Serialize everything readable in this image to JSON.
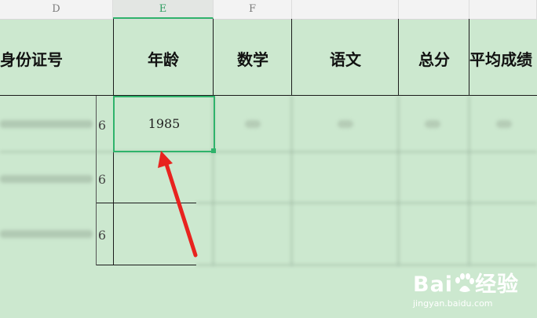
{
  "sheet": {
    "columns": [
      "D",
      "E",
      "F"
    ],
    "selected_column": "E",
    "headers": [
      "身份证号",
      "年龄",
      "数学",
      "语文",
      "总分",
      "平均成绩"
    ],
    "rows": [
      {
        "id_suffix": "6",
        "age": "1985"
      },
      {
        "id_suffix": "6",
        "age": ""
      },
      {
        "id_suffix": "6",
        "age": ""
      }
    ],
    "active_cell_value": "1985"
  },
  "watermark": {
    "logo": "Baidu经验",
    "url": "jingyan.baidu.com"
  },
  "colors": {
    "background": "#cce8cf",
    "selection": "#2fb36b",
    "arrow": "#e8231f"
  },
  "icons": [
    "red-arrow-annotation-icon",
    "baidu-paw-icon"
  ]
}
